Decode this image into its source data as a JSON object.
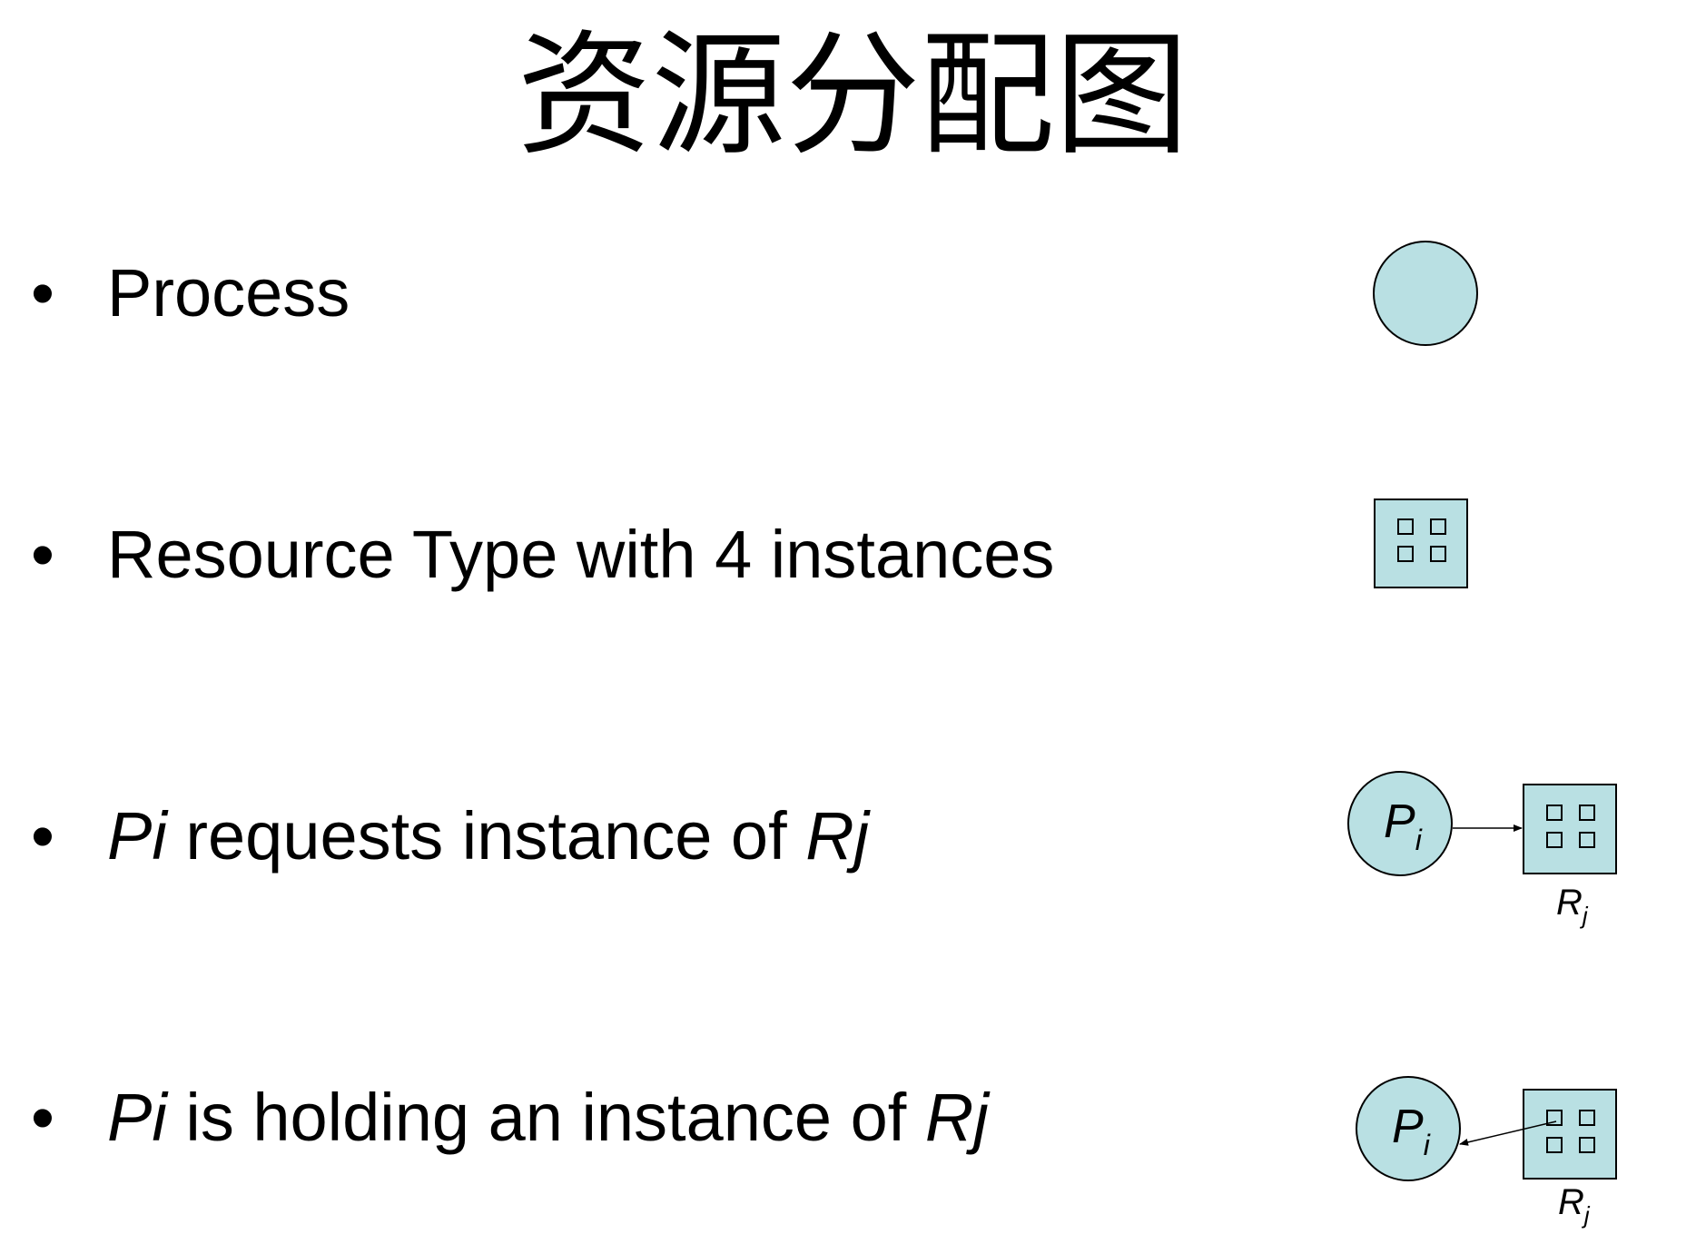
{
  "title": "资源分配图",
  "bullets": [
    {
      "marker": "•",
      "segments": [
        {
          "text": "Process",
          "italic": false
        }
      ]
    },
    {
      "marker": "•",
      "segments": [
        {
          "text": "Resource Type with 4 instances",
          "italic": false
        }
      ]
    },
    {
      "marker": "•",
      "segments": [
        {
          "text": "Pi",
          "italic": true
        },
        {
          "text": " requests instance of ",
          "italic": false
        },
        {
          "text": "Rj",
          "italic": true
        }
      ]
    },
    {
      "marker": "•",
      "segments": [
        {
          "text": "Pi",
          "italic": true
        },
        {
          "text": " is holding an instance of ",
          "italic": false
        },
        {
          "text": "Rj",
          "italic": true
        }
      ]
    }
  ],
  "diagram": {
    "process_label": "P",
    "process_sub": "i",
    "resource_label": "R",
    "resource_sub": "j",
    "fill_color": "#b9e0e3",
    "stroke_color": "#000000"
  }
}
